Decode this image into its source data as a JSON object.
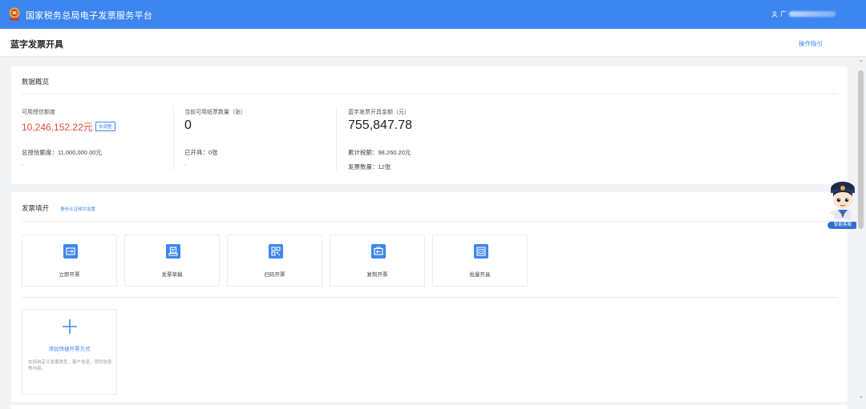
{
  "header": {
    "app_title": "国家税务总局电子发票服务平台",
    "user_name": "广"
  },
  "page": {
    "title": "蓝字发票开具",
    "guide_link": "操作指引"
  },
  "overview": {
    "title": "数据概览",
    "credit": {
      "label": "可用授信额度",
      "value": "10,246,152.22元",
      "adjust_button": "去调整",
      "total_label": "总授信额度：",
      "total_value": "11,000,000.00元",
      "dash": "-"
    },
    "paper": {
      "label": "当前可用纸票数量（张）",
      "value": "0",
      "issued_label": "已开具：",
      "issued_value": "0张",
      "dash": "-"
    },
    "amount": {
      "label": "蓝字发票开具金额（元）",
      "value": "755,847.78",
      "tax_label": "累计税额：",
      "tax_value": "98,260.20元",
      "count_label": "发票数量：",
      "count_value": "12张"
    }
  },
  "filling": {
    "title": "发票填开",
    "identity_link": "身份认证频次设置",
    "tiles": [
      {
        "label": "立即开票",
        "icon": "invoice-icon"
      },
      {
        "label": "发票草稿",
        "icon": "draft-icon"
      },
      {
        "label": "扫码开票",
        "icon": "qrcode-icon"
      },
      {
        "label": "复制开票",
        "icon": "copy-invoice-icon"
      },
      {
        "label": "批量开具",
        "icon": "batch-icon"
      }
    ],
    "add": {
      "label": "添加快捷开票方式",
      "description": "支持自定义发票类型、客户信息、项目信息等内容。"
    }
  },
  "mascot": {
    "caption": "智能客服"
  },
  "colors": {
    "brand": "#3d86f0",
    "accent_red": "#e8483c",
    "background": "#f2f3f5"
  }
}
